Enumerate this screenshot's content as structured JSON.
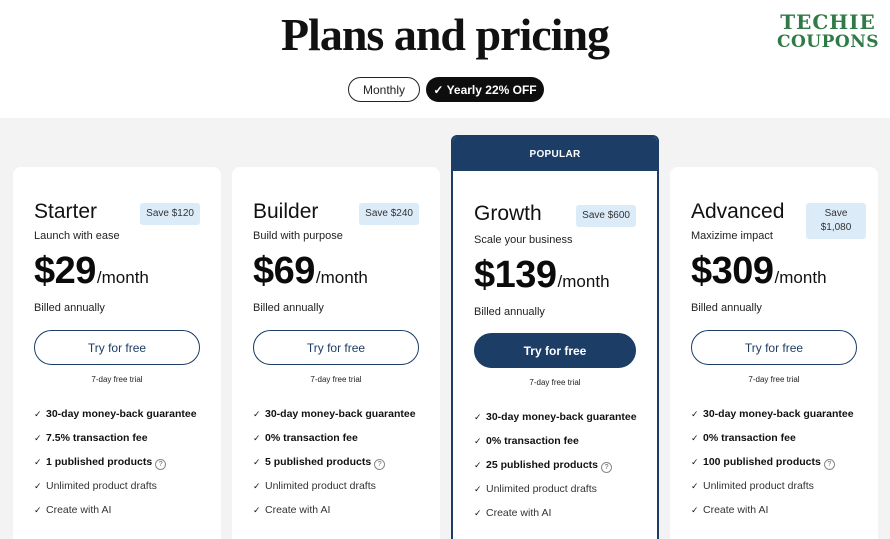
{
  "header": {
    "title": "Plans and pricing",
    "watermark_line1": "TECHIE",
    "watermark_line2": "COUPONS"
  },
  "billing_toggle": {
    "monthly_label": "Monthly",
    "yearly_label": "✓ Yearly 22% OFF",
    "selected": "Yearly"
  },
  "colors": {
    "accent": "#1c3d66",
    "save_badge": "#dcebf8",
    "background": "#f3f3f3"
  },
  "plans": [
    {
      "name": "Starter",
      "save": "Save $120",
      "tagline": "Launch with ease",
      "price": "$29",
      "period": "/month",
      "billed": "Billed annually",
      "cta": "Try for free",
      "trial": "7-day free trial",
      "features": [
        "30-day money-back guarantee",
        "7.5% transaction fee",
        "1 published products",
        "Unlimited product drafts",
        "Create with AI"
      ]
    },
    {
      "name": "Builder",
      "save": "Save $240",
      "tagline": "Build with purpose",
      "price": "$69",
      "period": "/month",
      "billed": "Billed annually",
      "cta": "Try for free",
      "trial": "7-day free trial",
      "features": [
        "30-day money-back guarantee",
        "0% transaction fee",
        "5 published products",
        "Unlimited product drafts",
        "Create with AI"
      ]
    },
    {
      "badge": "POPULAR",
      "name": "Growth",
      "save": "Save $600",
      "tagline": "Scale your business",
      "price": "$139",
      "period": "/month",
      "billed": "Billed annually",
      "cta": "Try for free",
      "trial": "7-day free trial",
      "features": [
        "30-day money-back guarantee",
        "0% transaction fee",
        "25 published products",
        "Unlimited product drafts",
        "Create with AI"
      ]
    },
    {
      "name": "Advanced",
      "save_line1": "Save",
      "save_line2": "$1,080",
      "tagline": "Maxizime impact",
      "price": "$309",
      "period": "/month",
      "billed": "Billed annually",
      "cta": "Try for free",
      "trial": "7-day free trial",
      "features": [
        "30-day money-back guarantee",
        "0% transaction fee",
        "100 published products",
        "Unlimited product drafts",
        "Create with AI"
      ]
    }
  ],
  "icons": {
    "check": "check-icon",
    "info": "info-icon"
  }
}
